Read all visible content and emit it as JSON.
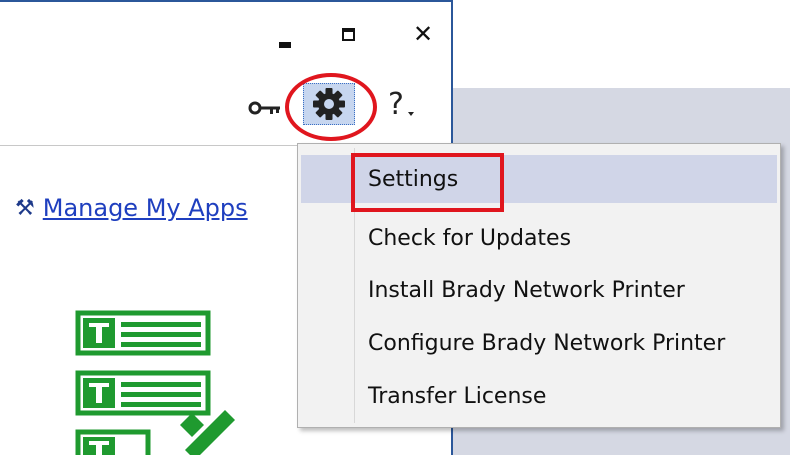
{
  "window_controls": {
    "minimize": "minimize-icon",
    "maximize": "maximize-icon",
    "close": "✕"
  },
  "toolbar": {
    "key_icon": "key-icon",
    "gear_icon": "gear-icon",
    "help_label": "?"
  },
  "manage_apps": {
    "icon": "tools-icon",
    "label": "Manage My Apps"
  },
  "settings_menu": {
    "items": [
      {
        "label": "Settings",
        "highlighted": true
      },
      {
        "label": "Check for Updates"
      },
      {
        "label": "Install Brady Network Printer"
      },
      {
        "label": "Configure Brady Network Printer"
      },
      {
        "label": "Transfer License"
      }
    ]
  },
  "colors": {
    "accent": "#2b579a",
    "annotation_red": "#e0161e",
    "link_blue": "#1f3fbf",
    "app_green": "#1f9a2f",
    "menu_highlight": "#d0d5e8"
  }
}
